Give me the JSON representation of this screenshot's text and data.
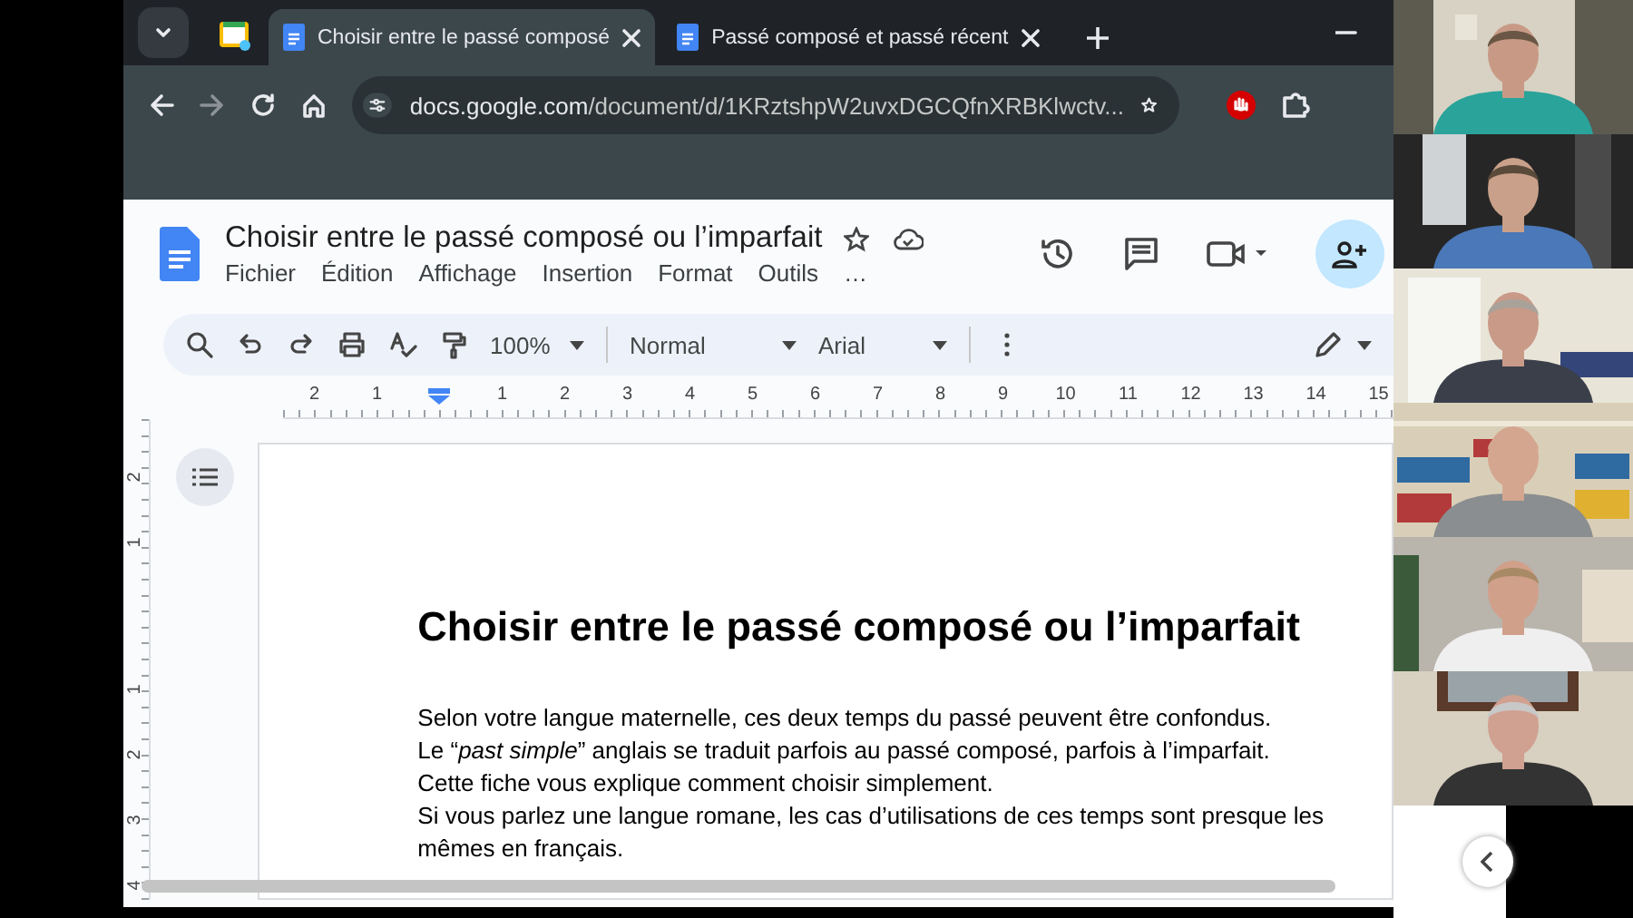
{
  "browser": {
    "tabs": [
      {
        "title": "Choisir entre le passé composé",
        "selected": true
      },
      {
        "title": "Passé composé et passé récent",
        "selected": false
      }
    ],
    "url_host": "docs.google.com",
    "url_path": "/document/d/1KRztshpW2uvxDGCQfnXRBKlwctv..."
  },
  "document": {
    "title": "Choisir entre le passé composé ou l’imparfait",
    "menu": [
      "Fichier",
      "Édition",
      "Affichage",
      "Insertion",
      "Format",
      "Outils",
      "…"
    ],
    "zoom": "100%",
    "style": "Normal",
    "font": "Arial",
    "ruler": [
      "2",
      "1",
      "1",
      "2",
      "3",
      "4",
      "5",
      "6",
      "7",
      "8",
      "9",
      "10",
      "11",
      "12",
      "13",
      "14",
      "15"
    ],
    "vertical_ruler": [
      "2",
      "1",
      "1",
      "2",
      "3",
      "4"
    ],
    "heading": "Choisir entre le passé composé ou l’imparfait",
    "paragraphs": [
      "Selon votre langue maternelle, ces deux temps du passé peuvent être confondus.",
      "Le “*past simple*” anglais se traduit parfois au passé composé, parfois à l’imparfait.",
      "Cette fiche vous explique comment choisir simplement.",
      "Si vous parlez une langue romane, les cas d’utilisations de ces temps sont presque les mêmes en français."
    ]
  }
}
